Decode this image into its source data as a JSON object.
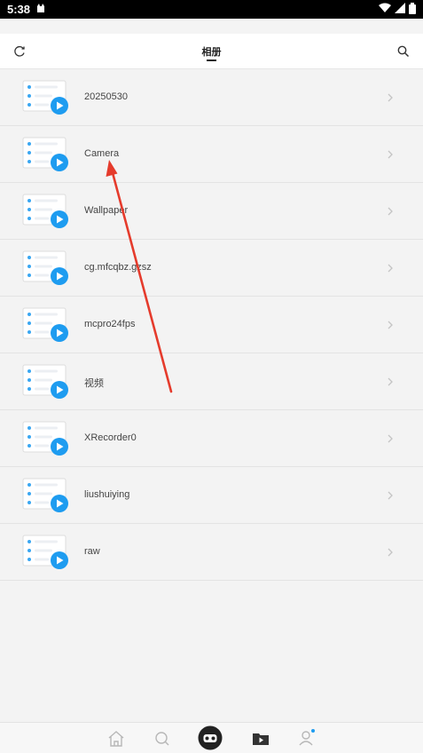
{
  "status_bar": {
    "time": "5:38"
  },
  "header": {
    "title": "相册",
    "refresh_icon": "refresh-icon",
    "search_icon": "search-icon"
  },
  "albums": [
    {
      "name": "20250530"
    },
    {
      "name": "Camera"
    },
    {
      "name": "Wallpaper"
    },
    {
      "name": "cg.mfcqbz.gzsz"
    },
    {
      "name": "mcpro24fps"
    },
    {
      "name": "视频"
    },
    {
      "name": "XRecorder0"
    },
    {
      "name": "liushuiying"
    },
    {
      "name": "raw"
    }
  ],
  "bottom_nav": {
    "items": [
      "home-icon",
      "search-icon",
      "vr-icon",
      "video-folder-icon",
      "user-icon"
    ]
  },
  "colors": {
    "accent": "#1e9cf0",
    "annotation_arrow": "#e53b2c"
  }
}
